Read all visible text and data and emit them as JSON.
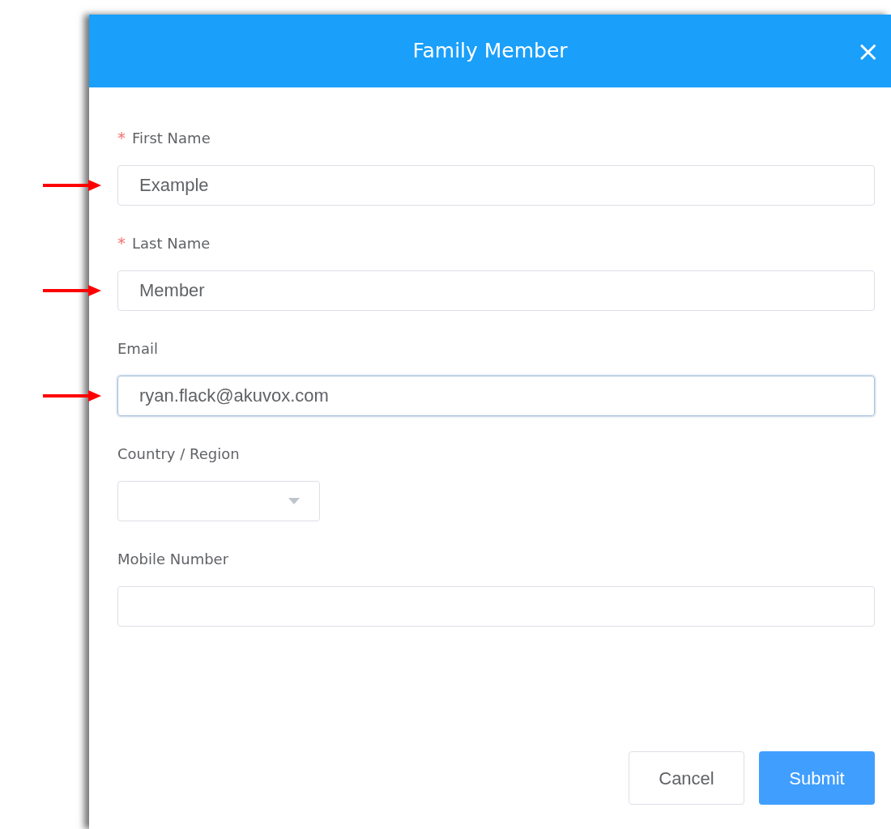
{
  "dialog": {
    "title": "Family Member",
    "close": "×"
  },
  "fields": [
    {
      "kind": "text",
      "label": "First Name",
      "required": true,
      "value": "Example",
      "marked": true,
      "focused": false
    },
    {
      "kind": "text",
      "label": "Last Name",
      "required": true,
      "value": "Member",
      "marked": true,
      "focused": false
    },
    {
      "kind": "text",
      "label": "Email",
      "required": false,
      "value": "ryan.flack@akuvox.com",
      "marked": true,
      "focused": true
    },
    {
      "kind": "select",
      "label": "Country / Region",
      "required": false,
      "marked": false,
      "focused": false
    },
    {
      "kind": "text",
      "label": "Mobile Number",
      "required": false,
      "marked": false,
      "focused": false
    }
  ],
  "required_mark": "*",
  "buttons": [
    {
      "label": "Cancel",
      "primary": false
    },
    {
      "label": "Submit",
      "primary": true
    }
  ]
}
